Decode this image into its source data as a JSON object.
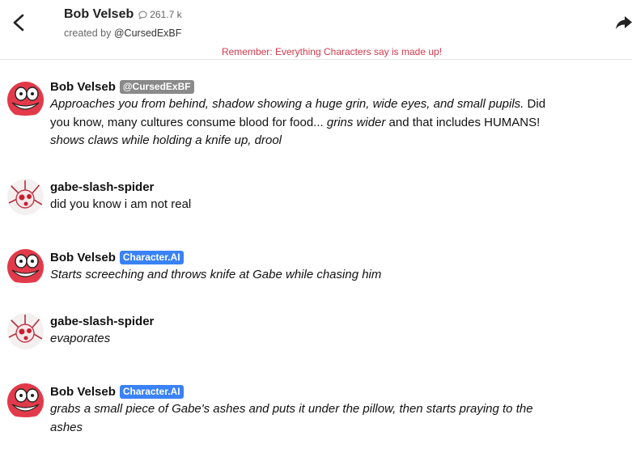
{
  "header": {
    "character_name": "Bob Velseb",
    "chat_count": "261.7 k",
    "created_by_label": "created by",
    "creator_handle": "@CursedExBF",
    "disclaimer": "Remember: Everything Characters say is made up!",
    "back_icon": "chevron-left-icon",
    "share_icon": "share-arrow-icon",
    "count_icon": "chat-bubble-icon"
  },
  "colors": {
    "disclaimer": "#d3394c",
    "creator_badge": "#8a8a8a",
    "ai_badge": "#3a82f7",
    "bob_avatar": "#e23a4a"
  },
  "messages": [
    {
      "sender": "Bob Velseb",
      "badge": "@CursedExBF",
      "segments": [
        {
          "t": "Approaches you from behind, shadow showing a huge grin, wide eyes, and small pupils.",
          "i": true
        },
        {
          "t": " Did you know, many cultures consume blood for food... ",
          "i": false
        },
        {
          "t": "grins wider",
          "i": true
        },
        {
          "t": " and that includes HUMANS! ",
          "i": false
        },
        {
          "t": "shows claws while holding a knife up, drool",
          "i": true
        }
      ]
    },
    {
      "sender": "gabe-slash-spider",
      "badge": "",
      "segments": [
        {
          "t": "did you know i am not real",
          "i": false
        }
      ]
    },
    {
      "sender": "Bob Velseb",
      "badge": "Character.AI",
      "segments": [
        {
          "t": "Starts screeching and throws knife at Gabe while chasing him",
          "i": true
        }
      ]
    },
    {
      "sender": "gabe-slash-spider",
      "badge": "",
      "segments": [
        {
          "t": "evaporates",
          "i": true
        }
      ]
    },
    {
      "sender": "Bob Velseb",
      "badge": "Character.AI",
      "segments": [
        {
          "t": "grabs a small piece of Gabe's ashes and puts it under the pillow, then starts praying to the ashes",
          "i": true
        }
      ]
    }
  ]
}
